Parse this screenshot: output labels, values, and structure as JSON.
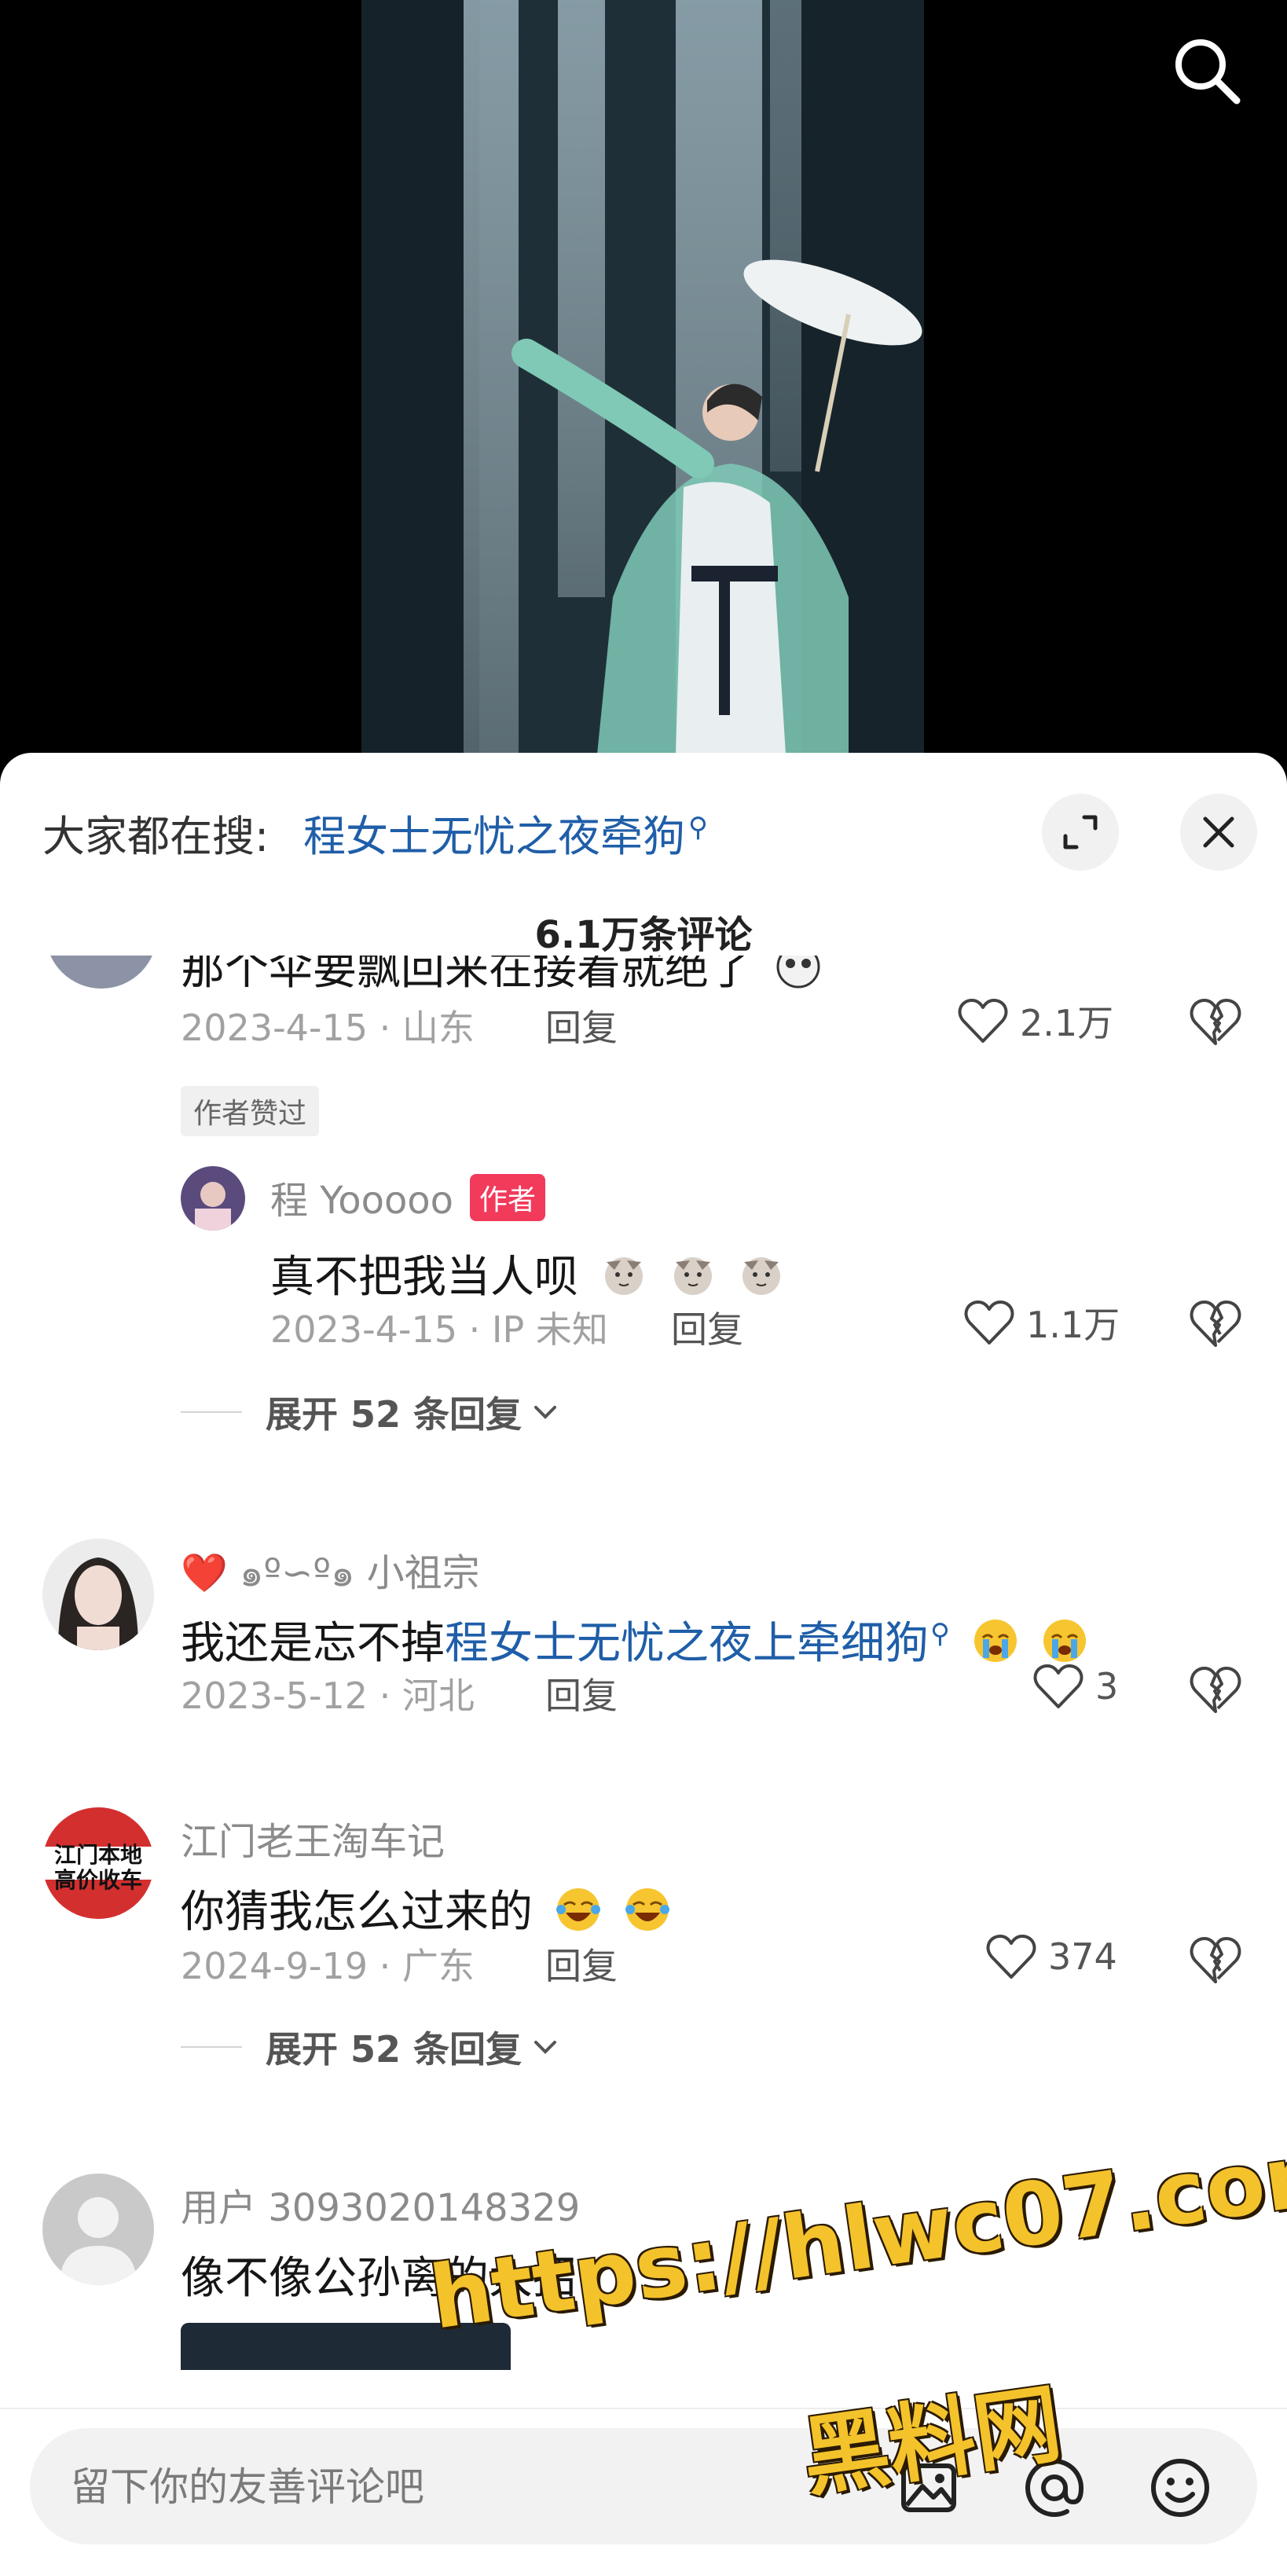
{
  "trending": {
    "label": "大家都在搜:",
    "query": "程女士无忧之夜牵狗",
    "search_glyph": "⚲"
  },
  "comments_header": {
    "title": "6.1万条评论"
  },
  "comments": [
    {
      "partial_text": "那个伞要飘回来在接着就绝了",
      "date_loc": "2023-4-15 · 山东",
      "reply_label": "回复",
      "likes": "2.1万",
      "author_liked": "作者赞过",
      "replies": [
        {
          "username": "程 Yooooo",
          "author_tag": "作者",
          "text": "真不把我当人呗",
          "date_loc": "2023-4-15 · IP 未知",
          "reply_label": "回复",
          "likes": "1.1万"
        }
      ],
      "expand_label": "展开 52 条回复"
    },
    {
      "username": "❤️ ๑º∽º๑ 小祖宗",
      "text_prefix": "我还是忘不掉",
      "text_link": "程女士无忧之夜上牵细狗",
      "date_loc": "2023-5-12 · 河北",
      "reply_label": "回复",
      "likes": "3"
    },
    {
      "username": "江门老王淘车记",
      "avatar_text": "江门本地高价收车",
      "text": "你猜我怎么过来的",
      "date_loc": "2024-9-19 · 广东",
      "reply_label": "回复",
      "likes": "374",
      "expand_label": "展开 52 条回复"
    },
    {
      "username": "用户 3093020148329",
      "text": "像不像公孙离的大招?"
    }
  ],
  "input": {
    "placeholder": "留下你的友善评论吧"
  },
  "watermark": {
    "line1": "https://hlwc07.com",
    "line2": "黑料网"
  },
  "icons": {
    "search": "search-icon",
    "expand": "expand-icon",
    "close": "close-icon",
    "heart": "heart-icon",
    "dislike": "broken-heart-icon",
    "image": "image-icon",
    "mention": "at-icon",
    "emoji": "emoji-icon"
  },
  "colors": {
    "link": "#1f5ea8",
    "author_tag": "#f23a5b",
    "watermark": "#f4c22b"
  }
}
